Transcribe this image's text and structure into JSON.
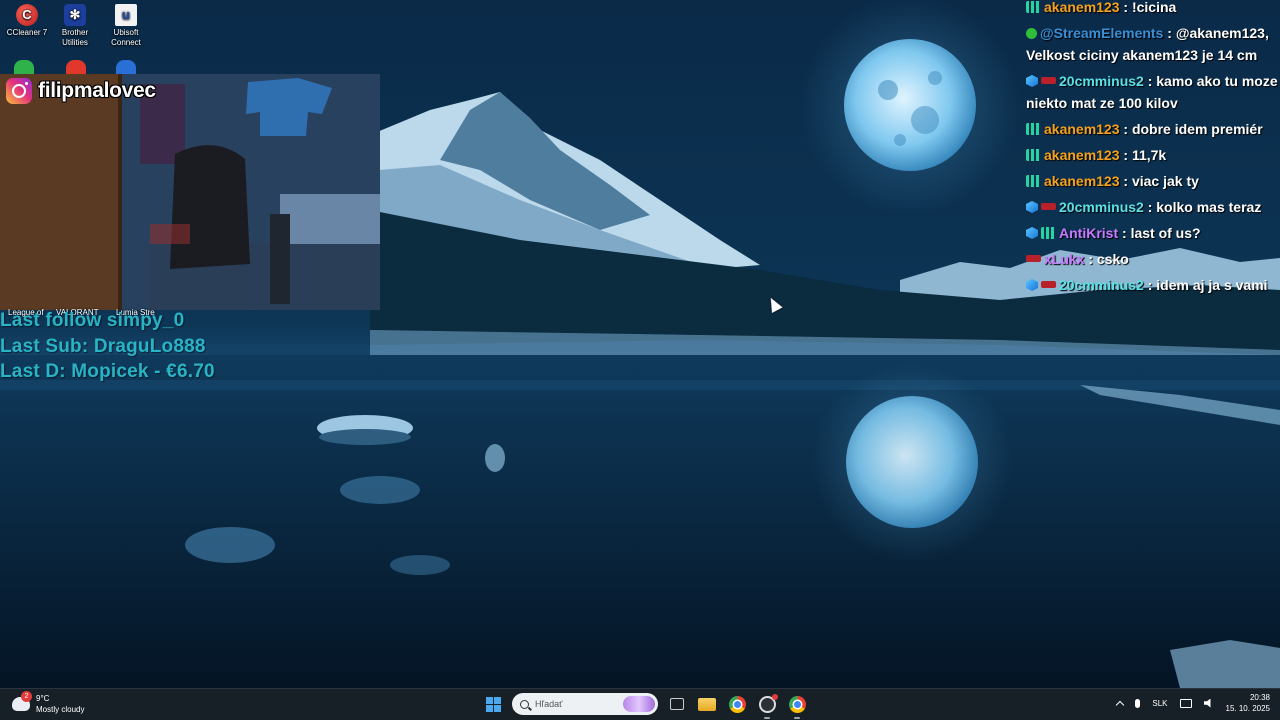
{
  "desktop": {
    "icons": [
      {
        "label": "CCleaner 7",
        "glyph": "C",
        "icon": "ccleaner-icon"
      },
      {
        "label": "Brother Utilities",
        "glyph": "✻",
        "icon": "brother-utilities-icon"
      },
      {
        "label": "Ubisoft Connect",
        "glyph": "u",
        "icon": "ubisoft-connect-icon"
      }
    ],
    "peek_labels": [
      "League of",
      "VALORANT",
      "Lumia Stre"
    ]
  },
  "overlay": {
    "instagram_handle": "filipmalovec",
    "last_follow": "Last follow simpy_0",
    "last_sub": "Last Sub: DraguLo888",
    "last_donation": "Last D: Mopicek - €6.70"
  },
  "chat": {
    "messages": [
      {
        "user": "akanem123",
        "color": "#f7a21c",
        "text": ": !cicina",
        "badges": [
          "bars"
        ]
      },
      {
        "user": "@StreamElements",
        "color": "#3b8fd6",
        "text": ": @akanem123, Velkost ciciny akanem123 je 14 cm",
        "badges": [
          "check"
        ]
      },
      {
        "user": "20cmminus2",
        "color": "#5ce1e6",
        "text": ": kamo ako tu moze niekto mat ze 100 kilov",
        "badges": [
          "cube",
          "red"
        ]
      },
      {
        "user": "akanem123",
        "color": "#f7a21c",
        "text": ": dobre idem premiér",
        "badges": [
          "bars"
        ]
      },
      {
        "user": "akanem123",
        "color": "#f7a21c",
        "text": ": 11,7k",
        "badges": [
          "bars"
        ]
      },
      {
        "user": "akanem123",
        "color": "#f7a21c",
        "text": ": viac jak ty",
        "badges": [
          "bars"
        ]
      },
      {
        "user": "20cmminus2",
        "color": "#5ce1e6",
        "text": ": kolko mas teraz",
        "badges": [
          "cube",
          "red"
        ]
      },
      {
        "user": "AntiKrist",
        "color": "#c97bff",
        "text": ": last of us?",
        "badges": [
          "cube",
          "bars"
        ]
      },
      {
        "user": "xLukx",
        "color": "#c97bff",
        "text": ": csko",
        "badges": [
          "red"
        ]
      },
      {
        "user": "20cmminus2",
        "color": "#5ce1e6",
        "text": ": idem aj ja s vami",
        "badges": [
          "cube",
          "red"
        ]
      }
    ]
  },
  "taskbar": {
    "weather_temp": "9°C",
    "weather_desc": "Mostly cloudy",
    "weather_badge": "2",
    "search_placeholder": "Hľadať",
    "language": "SLK",
    "time": "20:38",
    "date": "15. 10. 2025"
  },
  "colors": {
    "stat_text": "#29b4c5",
    "taskbar_bg": "#181e24"
  }
}
